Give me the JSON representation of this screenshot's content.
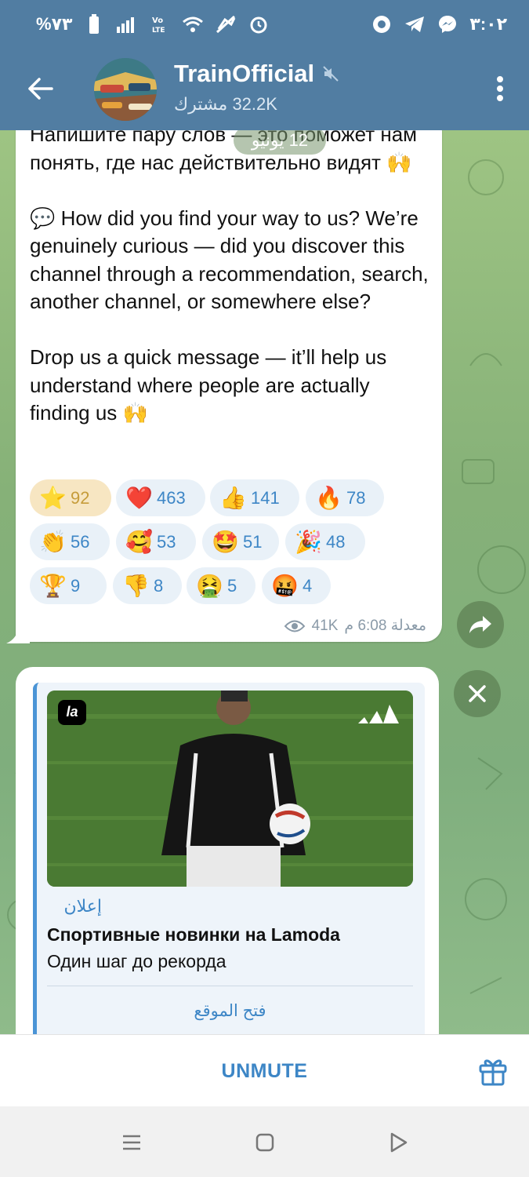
{
  "status_bar": {
    "time": "٣:٠٢",
    "battery": "%٧٣",
    "icons": [
      "battery-icon",
      "signal-icon",
      "volte-icon",
      "wifi-icon",
      "data-saver-icon",
      "alarm-icon",
      "chrome-icon",
      "telegram-icon",
      "messenger-icon"
    ]
  },
  "header": {
    "title": "TrainOfficial",
    "subscribers": "32.2K مشترك",
    "muted_icon": "muted-speaker-icon"
  },
  "message": {
    "text": "Напишите пару слов — это поможет нам понять, где нас действительно видят 🙌\n\n💬 How did you find your way to us? We’re genuinely curious — did you discover this channel through a recommendation, search, another channel, or somewhere else?\n\nDrop us a quick message — it’ll help us understand where people are actually finding us 🙌",
    "date_pill": "12 يونيو",
    "views": "41K",
    "time": "معدلة 6:08 م",
    "reactions": [
      {
        "emoji": "⭐",
        "count": "92",
        "chosen": true
      },
      {
        "emoji": "❤️",
        "count": "463"
      },
      {
        "emoji": "👍",
        "count": "141"
      },
      {
        "emoji": "🔥",
        "count": "78"
      },
      {
        "emoji": "👏",
        "count": "56"
      },
      {
        "emoji": "🥰",
        "count": "53"
      },
      {
        "emoji": "🤩",
        "count": "51"
      },
      {
        "emoji": "🎉",
        "count": "48"
      },
      {
        "emoji": "🏆",
        "count": "9"
      },
      {
        "emoji": "👎",
        "count": "8"
      },
      {
        "emoji": "🤮",
        "count": "5"
      },
      {
        "emoji": "🤬",
        "count": "4"
      }
    ]
  },
  "ad": {
    "label": "إعلان",
    "title": "Спортивные новинки на Lamoda",
    "description": "Один шаг до рекорда",
    "link": "فتح الموقع",
    "brand_badge": "la"
  },
  "bottom_bar": {
    "unmute_label": "UNMUTE"
  },
  "colors": {
    "header": "#517da2",
    "accent": "#3d86c6",
    "reaction_bg": "#e9f1f8",
    "chosen_reaction_bg": "#f7e6c2"
  }
}
